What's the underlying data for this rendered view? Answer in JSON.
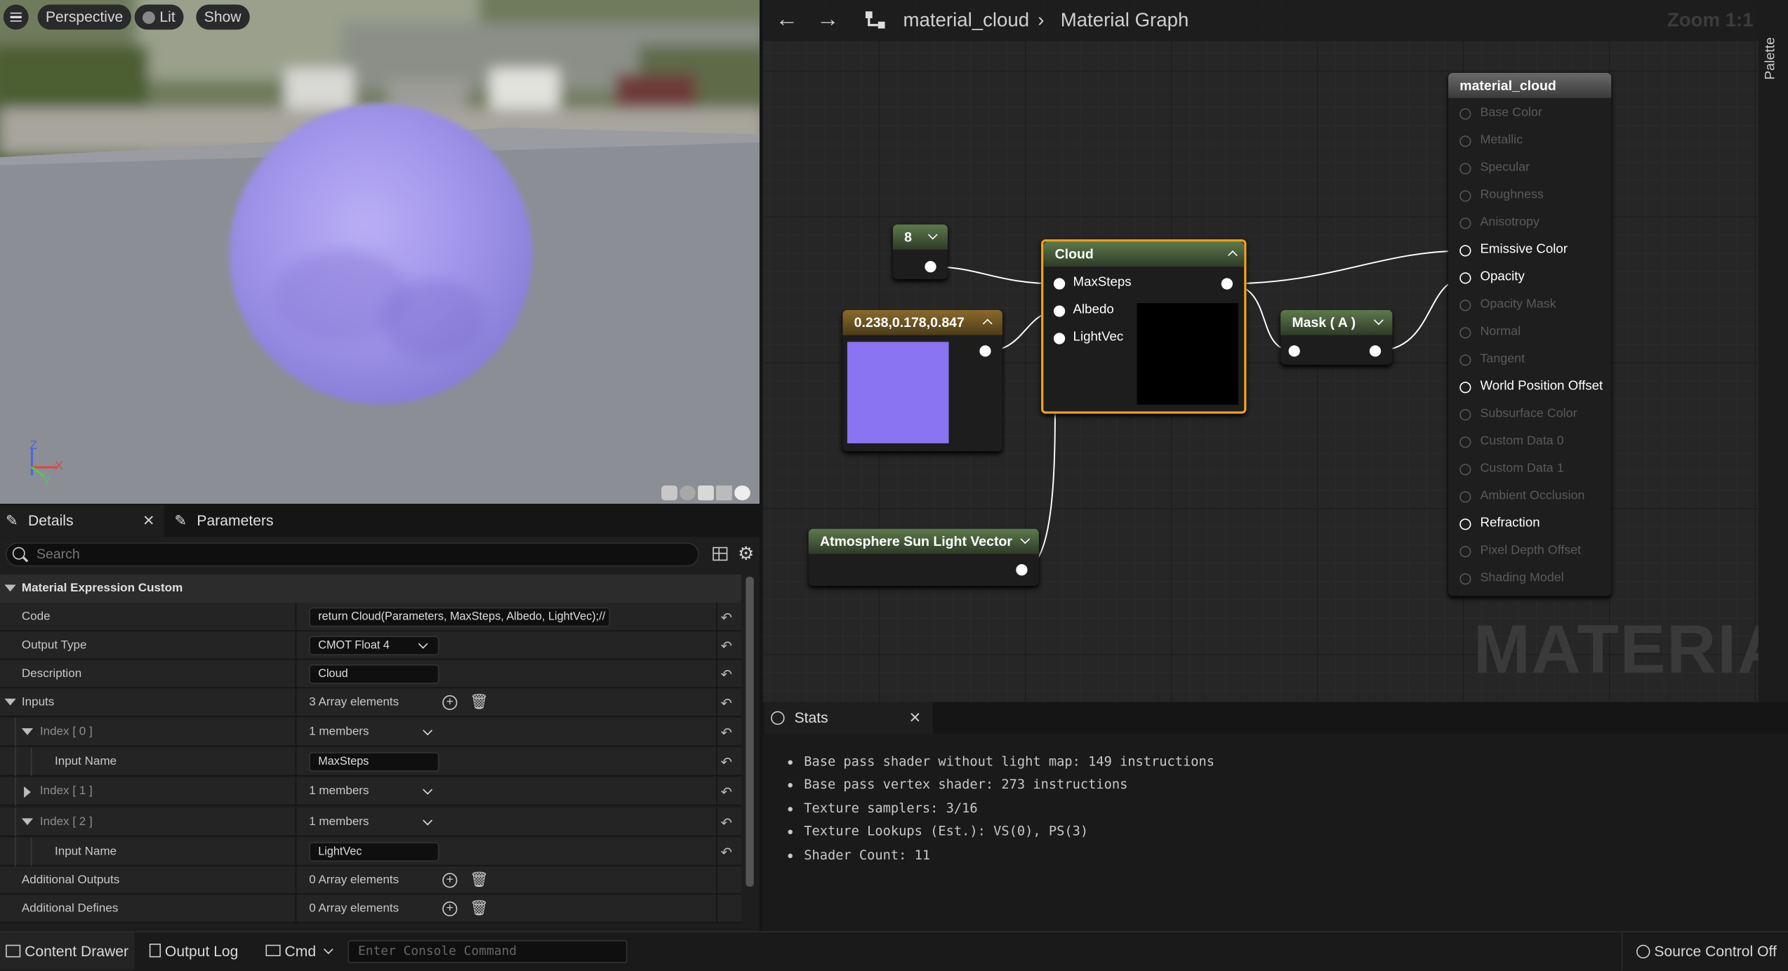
{
  "viewport": {
    "menu_icon": "hamburger-icon",
    "perspective_label": "Perspective",
    "lit_label": "Lit",
    "show_label": "Show",
    "axis_z": "Z",
    "axis_x": "X",
    "axis_y": "Y"
  },
  "details": {
    "tab_details": "Details",
    "tab_parameters": "Parameters",
    "search_placeholder": "Search",
    "section_title": "Material Expression Custom",
    "rows": {
      "code_label": "Code",
      "code_value": "return Cloud(Parameters, MaxSteps, Albedo, LightVec);//",
      "output_type_label": "Output Type",
      "output_type_value": "CMOT Float 4",
      "description_label": "Description",
      "description_value": "Cloud",
      "inputs_label": "Inputs",
      "inputs_value": "3 Array elements",
      "index0_label": "Index [ 0 ]",
      "index0_value": "1 members",
      "input_name_label": "Input Name",
      "input_name0_value": "MaxSteps",
      "index1_label": "Index [ 1 ]",
      "index1_value": "1 members",
      "index2_label": "Index [ 2 ]",
      "index2_value": "1 members",
      "input_name2_value": "LightVec",
      "additional_outputs_label": "Additional Outputs",
      "additional_outputs_value": "0 Array elements",
      "additional_defines_label": "Additional Defines",
      "additional_defines_value": "0 Array elements"
    }
  },
  "graph": {
    "breadcrumb_root": "material_cloud",
    "breadcrumb_child": "Material Graph",
    "zoom_label": "Zoom 1:1",
    "palette_label": "Palette",
    "watermark": "MATERIAL",
    "node_const": "8",
    "node_color_title": "0.238,0.178,0.847",
    "node_color_swatch": "#8a74f2",
    "node_cloud_title": "Cloud",
    "node_cloud_pins": [
      "MaxSteps",
      "Albedo",
      "LightVec"
    ],
    "node_mask_title": "Mask ( A )",
    "node_atmos_title": "Atmosphere Sun Light Vector",
    "result_title": "material_cloud",
    "result_pins": [
      {
        "label": "Base Color",
        "active": false
      },
      {
        "label": "Metallic",
        "active": false
      },
      {
        "label": "Specular",
        "active": false
      },
      {
        "label": "Roughness",
        "active": false
      },
      {
        "label": "Anisotropy",
        "active": false
      },
      {
        "label": "Emissive Color",
        "active": true
      },
      {
        "label": "Opacity",
        "active": true
      },
      {
        "label": "Opacity Mask",
        "active": false
      },
      {
        "label": "Normal",
        "active": false
      },
      {
        "label": "Tangent",
        "active": false
      },
      {
        "label": "World Position Offset",
        "active": true
      },
      {
        "label": "Subsurface Color",
        "active": false
      },
      {
        "label": "Custom Data 0",
        "active": false
      },
      {
        "label": "Custom Data 1",
        "active": false
      },
      {
        "label": "Ambient Occlusion",
        "active": false
      },
      {
        "label": "Refraction",
        "active": true
      },
      {
        "label": "Pixel Depth Offset",
        "active": false
      },
      {
        "label": "Shading Model",
        "active": false
      }
    ]
  },
  "stats": {
    "tab_label": "Stats",
    "lines": [
      "Base pass shader without light map: 149 instructions",
      "Base pass vertex shader: 273 instructions",
      "Texture samplers: 3/16",
      "Texture Lookups (Est.): VS(0), PS(3)",
      "Shader Count: 11"
    ]
  },
  "bottom_bar": {
    "content_drawer": "Content Drawer",
    "output_log": "Output Log",
    "cmd": "Cmd",
    "console_placeholder": "Enter Console Command",
    "source_control": "Source Control Off"
  }
}
